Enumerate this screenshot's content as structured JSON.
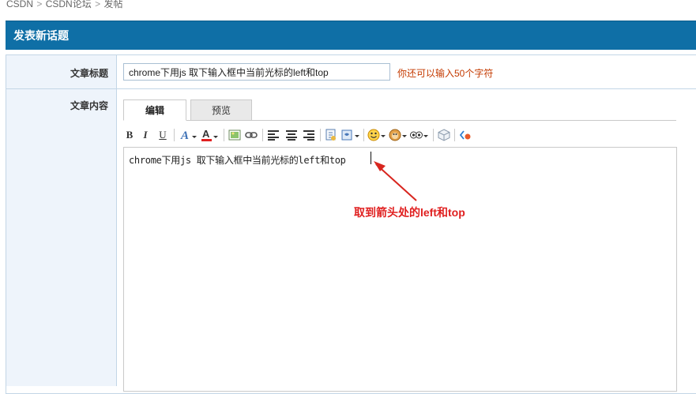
{
  "breadcrumb": {
    "items": [
      "CSDN",
      "CSDN论坛",
      "发帖"
    ],
    "separator": ">"
  },
  "header": {
    "title": "发表新话题"
  },
  "form": {
    "title_label": "文章标题",
    "title_value": "chrome下用js 取下输入框中当前光标的left和top",
    "title_hint": "你还可以输入50个字符",
    "content_label": "文章内容"
  },
  "editor": {
    "tabs": {
      "edit": "编辑",
      "preview": "预览"
    },
    "toolbar": {
      "bold": "B",
      "italic": "I",
      "underline": "U"
    },
    "content": "chrome下用js 取下输入框中当前光标的left和top"
  },
  "annotation": {
    "text": "取到箭头处的left和top",
    "color": "#e02020"
  },
  "colors": {
    "header_bg": "#0f6fa6",
    "label_bg": "#eef4fb",
    "border": "#c3d6e6",
    "hint": "#c43a00"
  }
}
